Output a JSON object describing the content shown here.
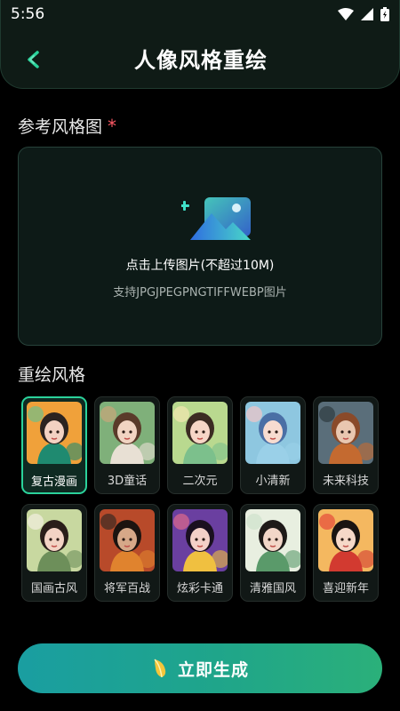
{
  "status_bar": {
    "time": "5:56"
  },
  "header": {
    "title": "人像风格重绘",
    "back_icon": "chevron-left-icon",
    "accent": "#2bd29b"
  },
  "reference": {
    "label": "参考风格图",
    "required_mark": "*",
    "upload_title": "点击上传图片(不超过10M)",
    "upload_formats": "支持JPGJPEGPNGTIFFWEBP图片"
  },
  "styles": {
    "label": "重绘风格",
    "selected_index": 0,
    "items": [
      {
        "label": "复古漫画",
        "icon": "retro-comic-portrait"
      },
      {
        "label": "3D童话",
        "icon": "3d-fairytale-portrait"
      },
      {
        "label": "二次元",
        "icon": "anime-portrait"
      },
      {
        "label": "小清新",
        "icon": "fresh-portrait"
      },
      {
        "label": "未来科技",
        "icon": "future-tech-portrait"
      },
      {
        "label": "国画古风",
        "icon": "ink-painting-portrait"
      },
      {
        "label": "将军百战",
        "icon": "general-warrior-portrait"
      },
      {
        "label": "炫彩卡通",
        "icon": "colorful-cartoon-portrait"
      },
      {
        "label": "清雅国风",
        "icon": "elegant-chinese-portrait"
      },
      {
        "label": "喜迎新年",
        "icon": "new-year-portrait"
      }
    ]
  },
  "generate": {
    "label": "立即生成",
    "icon": "sparkle-gem-icon"
  },
  "colors": {
    "background": "#000000",
    "header": "#0f1b16",
    "accent": "#2bd29b",
    "required": "#ff5a66"
  }
}
